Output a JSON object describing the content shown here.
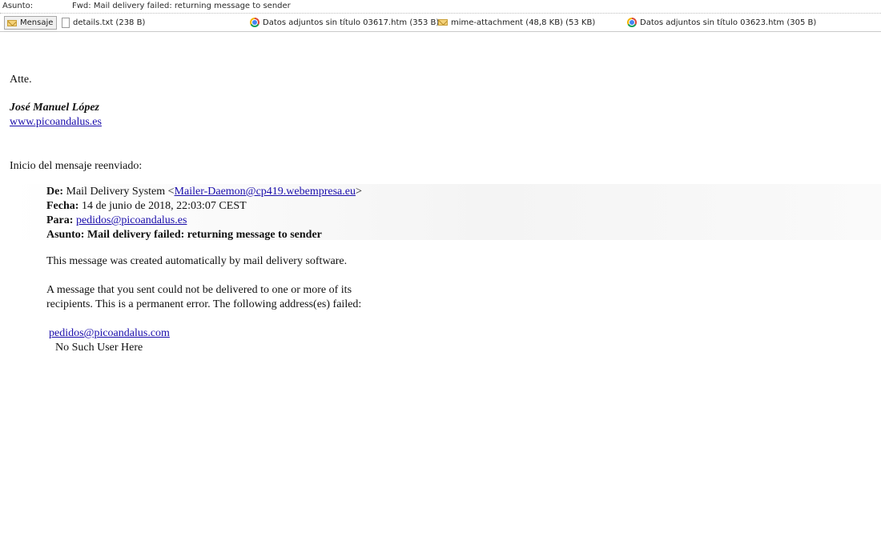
{
  "header": {
    "subject_label": "Asunto:",
    "subject_value": "Fwd: Mail delivery failed: returning message to sender"
  },
  "attachments": [
    {
      "label": "Mensaje",
      "icon": "envelope-icon",
      "selected": true
    },
    {
      "label": "details.txt (238 B)",
      "icon": "text-file-icon"
    },
    {
      "label": "Datos adjuntos sin título 03617.htm (353 B)",
      "icon": "chrome-icon"
    },
    {
      "label": "mime-attachment (48,8 KB) (53 KB)",
      "icon": "envelope-icon"
    },
    {
      "label": "Datos adjuntos sin título 03623.htm (305 B)",
      "icon": "chrome-icon"
    }
  ],
  "message": {
    "greeting": "Atte.",
    "signature_name": "José Manuel López",
    "signature_link": "www.picoandalus.es",
    "forward_intro": "Inicio del mensaje reenviado:",
    "forwarded": {
      "from_label": "De:",
      "from_name": "Mail Delivery System <",
      "from_email": "Mailer-Daemon@cp419.webempresa.eu",
      "from_suffix": ">",
      "date_label": "Fecha:",
      "date_value": "14 de junio de 2018, 22:03:07 CEST",
      "to_label": "Para:",
      "to_email": "pedidos@picoandalus.es",
      "subject_label": "Asunto:",
      "subject_value": "Mail delivery failed: returning message to sender"
    },
    "body_line1": "This message was created automatically by mail delivery software.",
    "body_line2": "A message that you sent could not be delivered to one or more of its",
    "body_line3": "recipients. This is a permanent error. The following address(es) failed:",
    "failed_address": "pedidos@picoandalus.com",
    "failed_reason": "No Such User Here"
  }
}
